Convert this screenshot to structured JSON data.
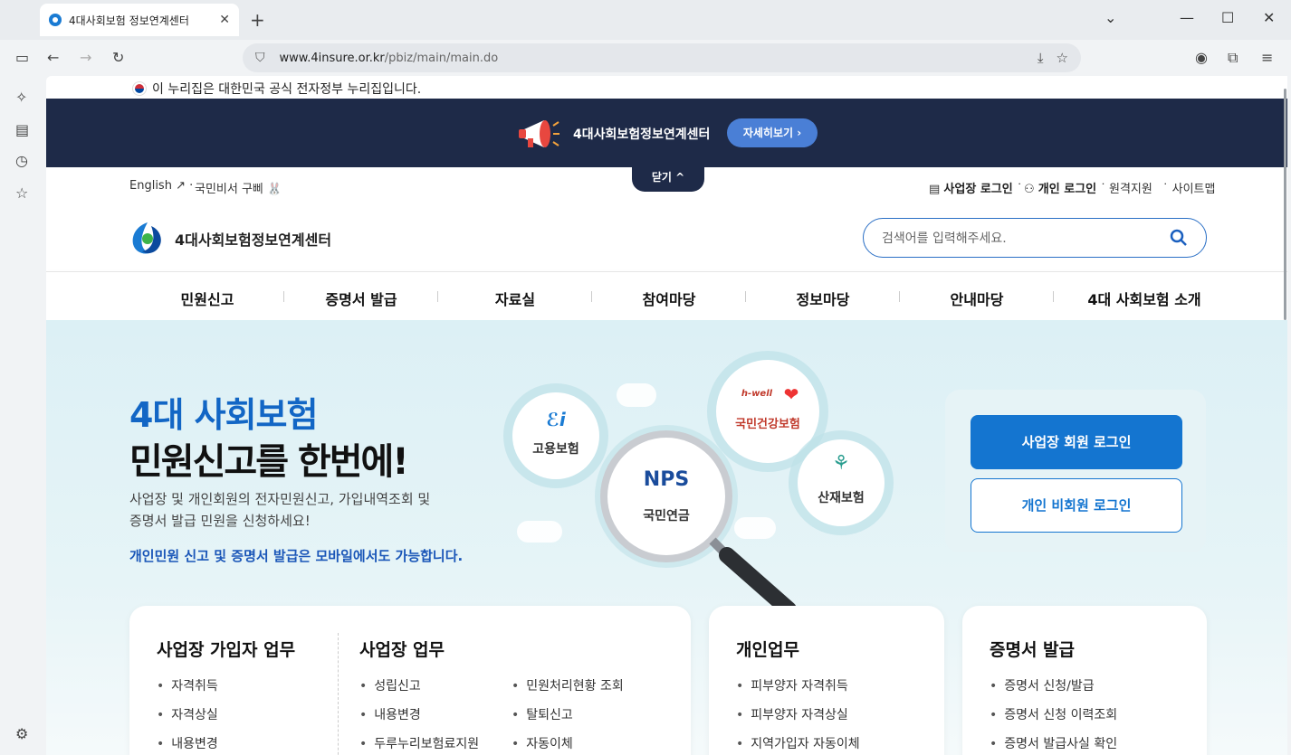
{
  "browser": {
    "tab_title": "4대사회보험 정보연계센터",
    "url_domain": "www.4insure.or.kr",
    "url_path": "/pbiz/main/main.do"
  },
  "gov_notice": "이 누리집은 대한민국 공식 전자정부 누리집입니다.",
  "banner": {
    "text": "4대사회보험정보연계센터",
    "button": "자세히보기 ›",
    "close": "닫기 ^"
  },
  "util": {
    "english": "English",
    "secretary": "국민비서 구삐",
    "biz_login": "사업장 로그인",
    "personal_login": "개인 로그인",
    "remote": "원격지원",
    "sitemap": "사이트맵"
  },
  "logo_text": "4대사회보험정보연계센터",
  "search_placeholder": "검색어를 입력해주세요.",
  "gnb": [
    "민원신고",
    "증명서 발급",
    "자료실",
    "참여마당",
    "정보마당",
    "안내마당",
    "4대 사회보험 소개"
  ],
  "hero": {
    "title_blue": "4대 사회보험",
    "title_black": "민원신고를 한번에!",
    "desc1": "사업장 및 개인회원의 전자민원신고, 가입내역조회 및",
    "desc2": "증명서 발급 민원을 신청하세요!",
    "mobile": "개인민원 신고 및 증명서 발급은 모바일에서도 가능합니다.",
    "circles": {
      "employment": "고용보험",
      "health_brand": "h-well",
      "health": "국민건강보험",
      "nps": "NPS",
      "pension": "국민연금",
      "industrial": "산재보험"
    },
    "biz_member_login": "사업장 회원 로그인",
    "personal_nonmember_login": "개인 비회원 로그인"
  },
  "cards": {
    "biz_subscriber": {
      "title": "사업장 가입자 업무",
      "items": [
        "자격취득",
        "자격상실",
        "내용변경"
      ]
    },
    "biz": {
      "title": "사업장 업무",
      "col1": [
        "성립신고",
        "내용변경",
        "두루누리보험료지원"
      ],
      "col2": [
        "민원처리현황 조회",
        "탈퇴신고",
        "자동이체"
      ]
    },
    "personal": {
      "title": "개인업무",
      "items": [
        "피부양자 자격취득",
        "피부양자 자격상실",
        "지역가입자 자동이체"
      ]
    },
    "cert": {
      "title": "증명서 발급",
      "items": [
        "증명서 신청/발급",
        "증명서 신청 이력조회",
        "증명서 발급사실 확인"
      ]
    }
  }
}
